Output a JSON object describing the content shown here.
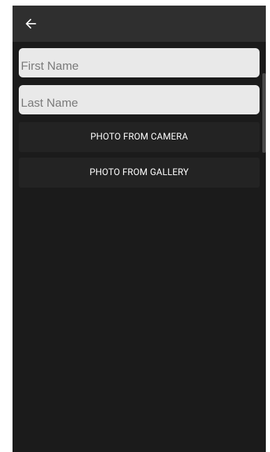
{
  "app_bar": {
    "back_icon": "arrow-left-icon"
  },
  "form": {
    "first_name": {
      "value": "",
      "placeholder": "First Name"
    },
    "last_name": {
      "value": "",
      "placeholder": "Last Name"
    }
  },
  "actions": {
    "camera_label": "PHOTO FROM CAMERA",
    "gallery_label": "PHOTO FROM GALLERY"
  },
  "colors": {
    "background": "#1b1b1b",
    "app_bar": "#2f2f2f",
    "field": "#e9e9e9",
    "button": "#232323"
  }
}
